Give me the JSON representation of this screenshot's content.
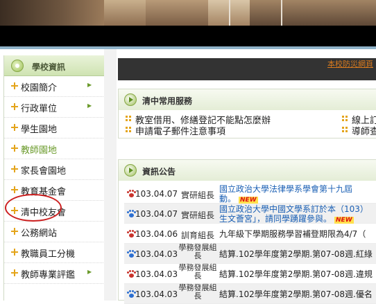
{
  "colors": {
    "accent": "#1a5fb4",
    "highlight_circle": "#cc1f1f",
    "bullet": "#e4a41a",
    "topbar": "#333333"
  },
  "sidebar": {
    "title": "學校資訊",
    "items": [
      {
        "label": "校園簡介",
        "arrow": true
      },
      {
        "label": "行政單位",
        "arrow": true
      },
      {
        "label": "學生園地",
        "arrow": false
      },
      {
        "label": "教師園地",
        "arrow": false,
        "circled": true
      },
      {
        "label": "家長會園地",
        "arrow": false
      },
      {
        "label": "教育基金會",
        "arrow": false
      },
      {
        "label": "清中校友會",
        "arrow": false
      },
      {
        "label": "公務網站",
        "arrow": false
      },
      {
        "label": "教職員工分機",
        "arrow": false
      },
      {
        "label": "教師專業評鑑",
        "arrow": true
      }
    ]
  },
  "topbar": {
    "link": "本校防災網頁"
  },
  "services": {
    "title": "清中常用服務",
    "items": [
      "教室借用、修繕登記不能點怎麼辦",
      "申請電子郵件注意事項",
      "線上訂",
      "導師查"
    ]
  },
  "news": {
    "title": "資訊公告",
    "rows": [
      {
        "date": "103.04.07",
        "unit": "實研組長",
        "title": "國立政治大學法律學系學會第十九屆",
        "title2": "動。",
        "new": "NEW",
        "paw": "red"
      },
      {
        "date": "103.04.07",
        "unit": "實研組長",
        "title": "國立政治大學中國文學系訂於本（103）",
        "title2": "生文薈宮」，請同學踴躍參與。",
        "new": "NEW",
        "paw": "blue"
      },
      {
        "date": "103.04.06",
        "unit": "訓育組長",
        "title": "九年級下學期服務學習補登期限為4/7（",
        "title2": "",
        "new": "",
        "paw": "red"
      },
      {
        "date": "103.04.03",
        "unit": "學務發展組長",
        "title": "結算.102學年度第2學期.第07-08週.紅綠",
        "title2": "",
        "new": "",
        "paw": "blue"
      },
      {
        "date": "103.04.03",
        "unit": "學務發展組長",
        "title": "結算.102學年度第2學期.第07-08週.違規",
        "title2": "",
        "new": "",
        "paw": "red"
      },
      {
        "date": "103.04.03",
        "unit": "學務發展組長",
        "title": "結算.102學年度第2學期.第07-08週.優名",
        "title2": "",
        "new": "",
        "paw": "blue"
      }
    ]
  }
}
